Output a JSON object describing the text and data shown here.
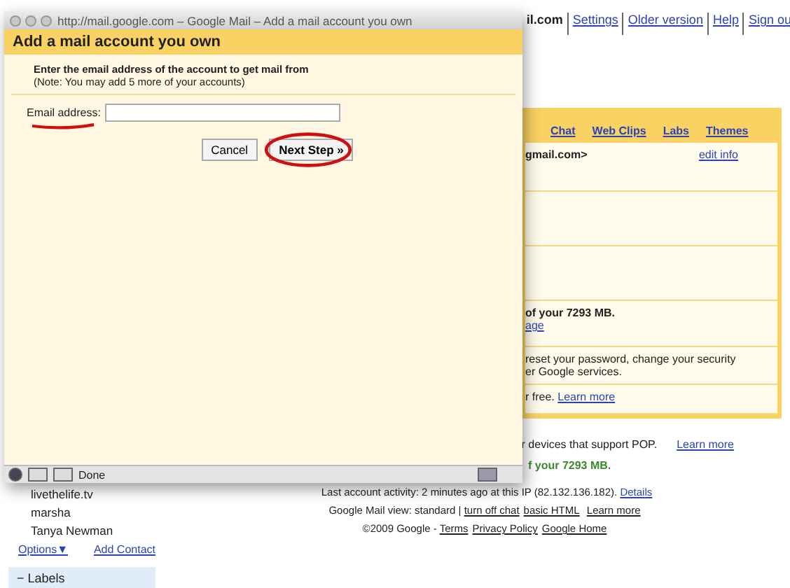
{
  "browser_window": {
    "title": "http://mail.google.com – Google Mail – Add a mail account you own",
    "status": "Done"
  },
  "dialog": {
    "title": "Add a mail account you own",
    "instruction": "Enter the email address of the account to get mail from",
    "note": "(Note: You may add 5 more of your accounts)",
    "email_label": "Email address:",
    "buttons": [
      {
        "label": "Cancel",
        "kind": "plain"
      },
      {
        "label": "Next Step »",
        "kind": "primary"
      }
    ]
  },
  "gmail_page": {
    "account": "il.com",
    "top_links": [
      "Settings",
      "Older version",
      "Help",
      "Sign ou"
    ],
    "settings_tabs": [
      "Chat",
      "Web Clips",
      "Labs",
      "Themes"
    ],
    "settings_rows": [
      {
        "text": "gmail.com>",
        "link": "edit info",
        "kind": "account"
      },
      {
        "kind": "empty"
      },
      {
        "kind": "empty"
      },
      {
        "text": "of your 7293 MB.",
        "link": "age",
        "kind": "storage"
      },
      {
        "text": "reset your password, change your security",
        "text2": "er Google services.",
        "kind": "para"
      },
      {
        "text": "r free.",
        "link": "Learn more",
        "kind": "inline"
      }
    ],
    "pop_text": "r devices that support POP.",
    "pop_link": "Learn more",
    "storage_text": "f your 7293 MB.",
    "footer": {
      "activity": "Last account activity: 2 minutes ago at this IP (82.132.136.182).",
      "details": "Details",
      "view": "Google Mail view: standard |",
      "view_links": [
        "turn off chat",
        "basic HTML"
      ],
      "learn_more": "Learn more",
      "copyright": "©2009 Google -",
      "legal_links": [
        "Terms",
        "Privacy Policy",
        "Google Home"
      ]
    },
    "contacts": [
      "livethelife.tv",
      "marsha",
      "Tanya Newman"
    ],
    "options_link": "Options▼",
    "add_contact": "Add Contact",
    "labels": {
      "toggle": "−",
      "title": "Labels"
    }
  }
}
